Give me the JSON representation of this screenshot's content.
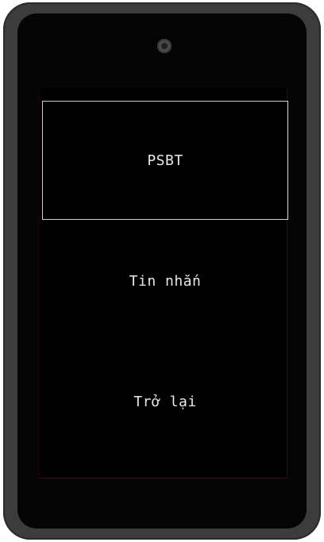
{
  "menu": {
    "items": [
      {
        "label": "PSBT",
        "selected": true
      },
      {
        "label": "Tin nhắn",
        "selected": false
      },
      {
        "label": "Trở lại",
        "selected": false
      }
    ]
  },
  "colors": {
    "device_frame": "#3c3c3c",
    "screen_background": "#000000",
    "text": "#e8e8e8",
    "selection_border": "#cfcfcf"
  }
}
